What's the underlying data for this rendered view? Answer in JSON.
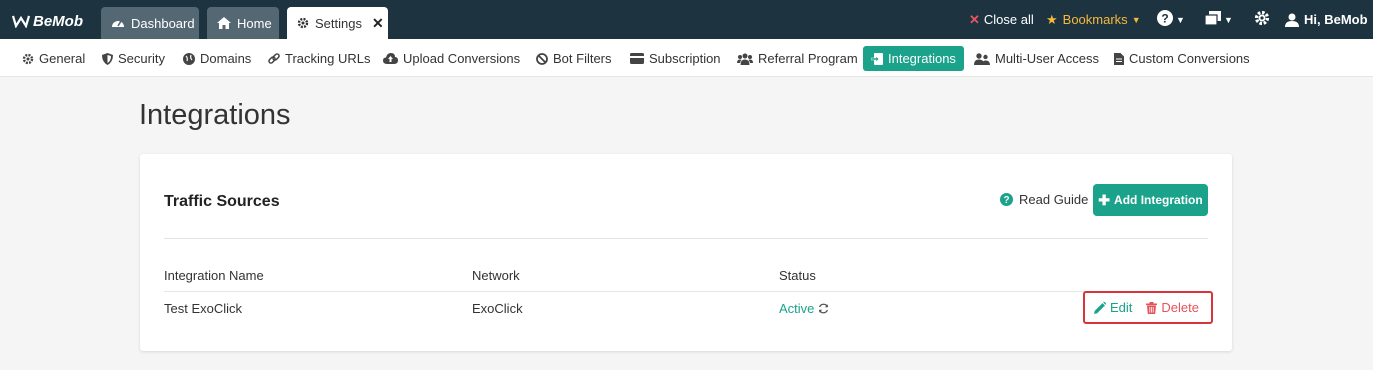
{
  "app": {
    "logo_text": "BeMob"
  },
  "tabs": [
    {
      "label": "Dashboard",
      "icon": "dashboard-icon"
    },
    {
      "label": "Home",
      "icon": "home-icon"
    },
    {
      "label": "Settings",
      "icon": "gear-icon",
      "close": "✕"
    }
  ],
  "topbar": {
    "close_all": "Close all",
    "bookmarks": "Bookmarks",
    "user_greeting": "Hi, BeMob"
  },
  "settings_nav": [
    {
      "label": "General",
      "icon": "gear-icon"
    },
    {
      "label": "Security",
      "icon": "shield-icon"
    },
    {
      "label": "Domains",
      "icon": "globe-icon"
    },
    {
      "label": "Tracking URLs",
      "icon": "link-icon"
    },
    {
      "label": "Upload Conversions",
      "icon": "cloud-upload-icon"
    },
    {
      "label": "Bot Filters",
      "icon": "ban-icon"
    },
    {
      "label": "Subscription",
      "icon": "credit-card-icon"
    },
    {
      "label": "Referral Program",
      "icon": "users-icon"
    },
    {
      "label": "Integrations",
      "icon": "sign-in-icon",
      "active": true
    },
    {
      "label": "Multi-User Access",
      "icon": "user-group-icon"
    },
    {
      "label": "Custom Conversions",
      "icon": "file-icon"
    }
  ],
  "page": {
    "title": "Integrations",
    "section_title": "Traffic Sources",
    "read_guide": "Read Guide",
    "add_button": "Add Integration"
  },
  "table": {
    "columns": [
      "Integration Name",
      "Network",
      "Status"
    ],
    "rows": [
      {
        "name": "Test ExoClick",
        "network": "ExoClick",
        "status": "Active",
        "edit": "Edit",
        "delete": "Delete"
      }
    ]
  },
  "colors": {
    "accent": "#1aa38a",
    "topbar": "#1d3340",
    "danger": "#e4545c",
    "bookmark": "#f6b93b"
  }
}
